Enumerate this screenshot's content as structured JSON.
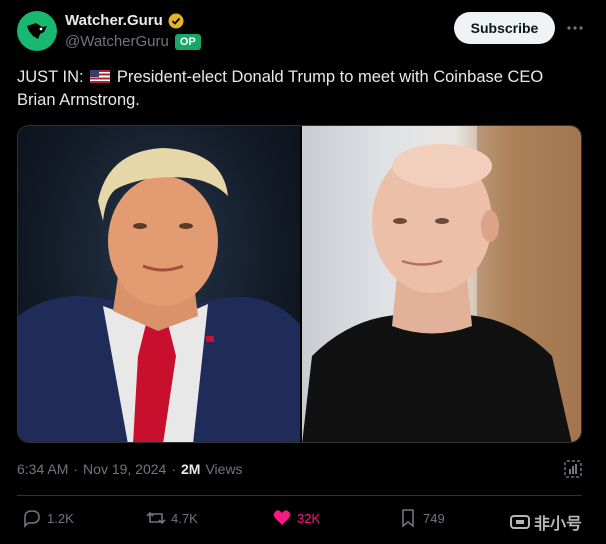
{
  "author": {
    "name": "Watcher.Guru",
    "handle": "@WatcherGuru",
    "badge": "OP",
    "verified_color": "#e6b325",
    "avatar_color": "#17b870"
  },
  "subscribe_label": "Subscribe",
  "tweet": {
    "prefix": "JUST IN:",
    "flag_icon": "us-flag-emoji",
    "body": "President-elect Donald Trump to meet with Coinbase CEO Brian Armstrong."
  },
  "media": {
    "images": [
      "trump-photo",
      "brian-armstrong-photo"
    ]
  },
  "meta": {
    "time": "6:34 AM",
    "separator": "·",
    "date": "Nov 19, 2024",
    "separator2": "·",
    "views_count": "2M",
    "views_label": "Views"
  },
  "actions": {
    "replies": "1.2K",
    "reposts": "4.7K",
    "likes": "32K",
    "bookmarks": "749",
    "like_color": "#f91880"
  },
  "watermark": {
    "text": "非小号"
  }
}
